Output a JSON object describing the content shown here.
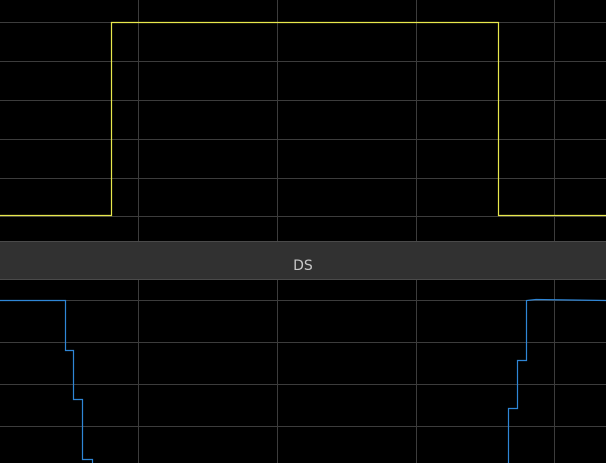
{
  "scope": {
    "signal_title": "DS"
  },
  "colors": {
    "background": "#000000",
    "grid": "#3c3c3c",
    "title_bar": "#313131",
    "title_text": "#c8c8c8",
    "trace_top": "#e8e84c",
    "trace_bottom": "#2f86d6"
  },
  "icons": []
}
